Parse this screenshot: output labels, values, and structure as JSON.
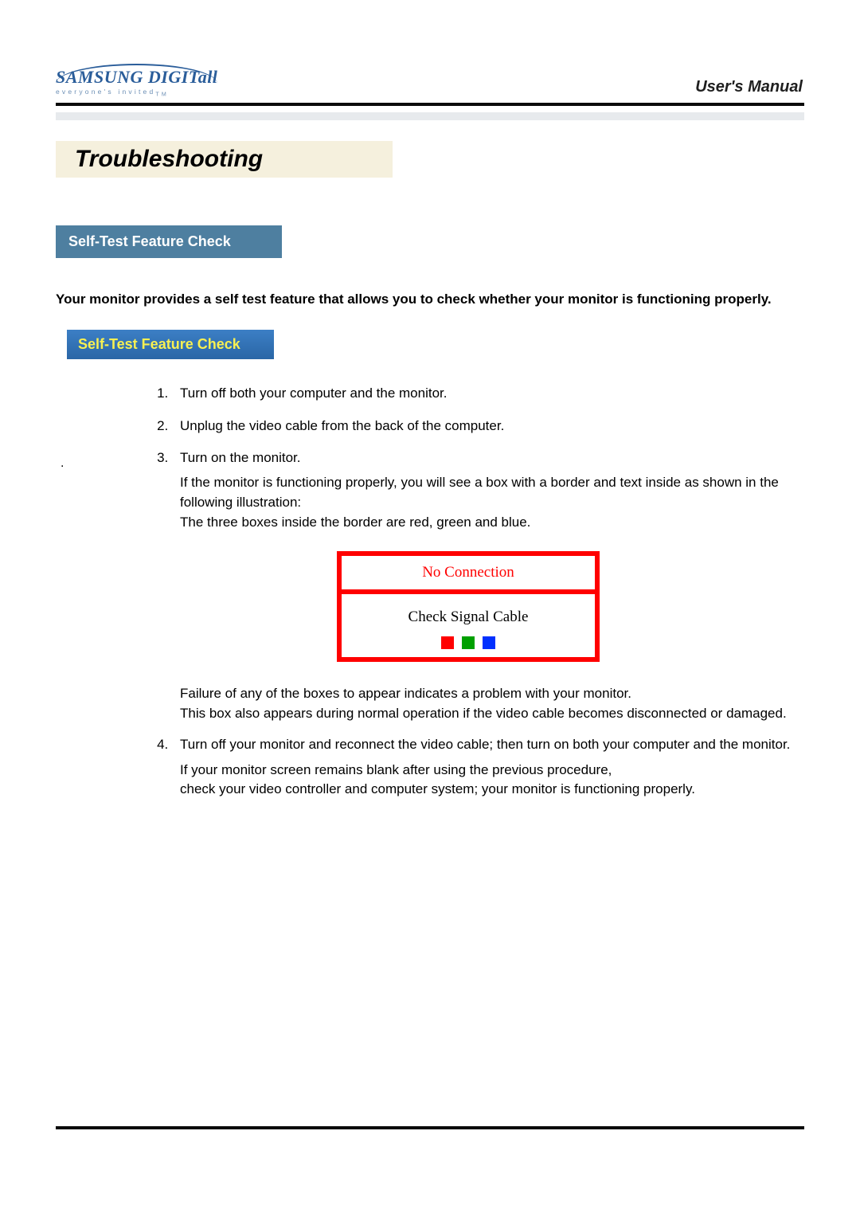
{
  "logo": {
    "brand_prefix": "SAMSUNG DIGIT",
    "brand_suffix": "all",
    "tagline": "everyone's invited",
    "tm": "TM"
  },
  "header": {
    "manual": "User's Manual"
  },
  "title": "Troubleshooting",
  "section_chip": "Self-Test Feature Check",
  "intro": "Your monitor provides a self test feature that allows you to check whether your monitor is functioning properly.",
  "subchip": "Self-Test Feature Check",
  "steps": {
    "s1": "Turn off both your computer and the monitor.",
    "s2": "Unplug the video cable from the back of the computer.",
    "s3": "Turn on the monitor.",
    "after3a": "If the monitor is functioning properly, you will see a box with a border and  text inside as shown in the following illustration:",
    "after3b": "The three boxes inside the border are red, green and blue.",
    "afterfig1": "Failure of any of the boxes to appear indicates a problem with your monitor.",
    "afterfig2": "This box also appears during normal operation if the video cable becomes disconnected or damaged.",
    "s4": "Turn off your monitor and reconnect the video cable; then turn on both your computer and the monitor.",
    "after4a": "If your monitor screen remains blank after using the previous procedure,",
    "after4b": "check your video controller and computer system; your monitor is functioning properly."
  },
  "illustration": {
    "header": "No Connection",
    "body": "Check Signal Cable"
  }
}
